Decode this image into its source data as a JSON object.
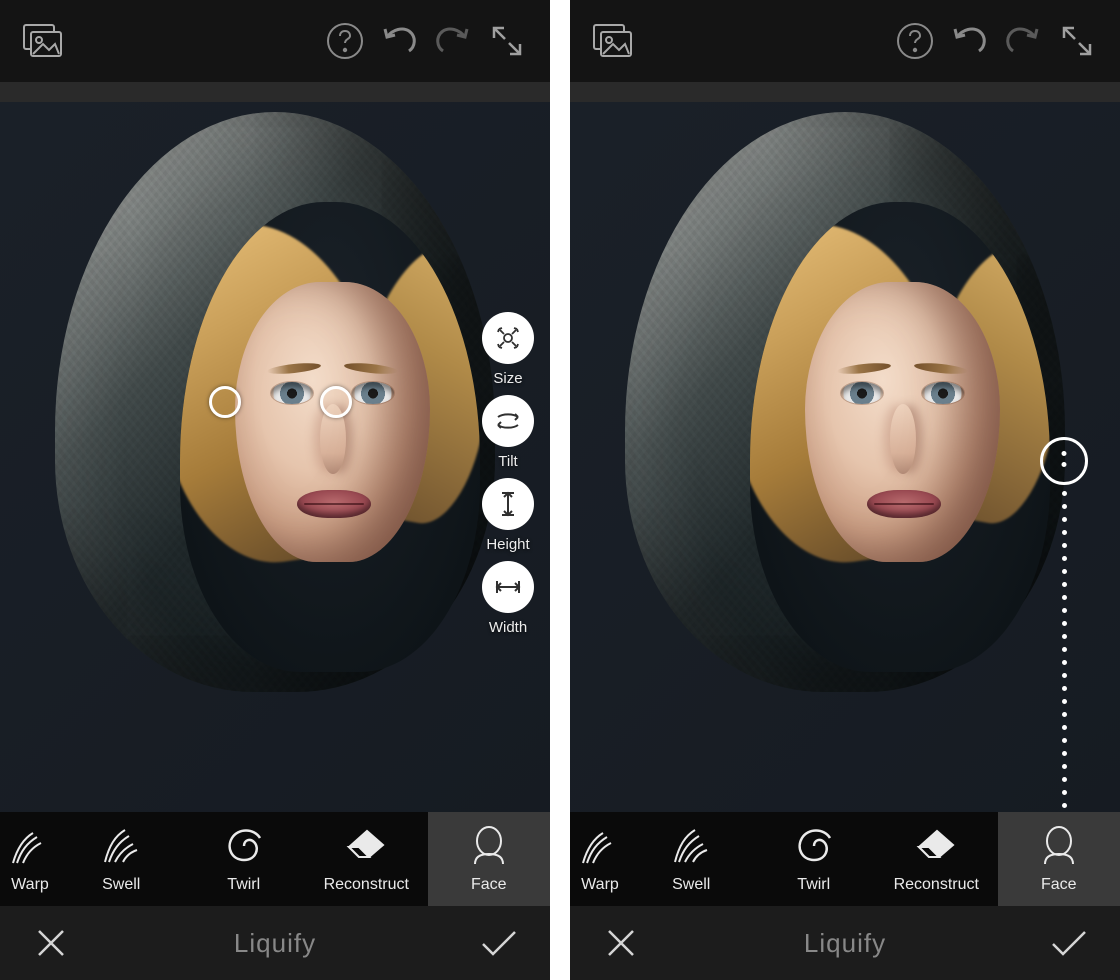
{
  "footer_label": "Liquify",
  "toolbar": {
    "warp": "Warp",
    "swell": "Swell",
    "twirl": "Twirl",
    "reconstruct": "Reconstruct",
    "face": "Face"
  },
  "face_tools": {
    "size": "Size",
    "tilt": "Tilt",
    "height": "Height",
    "width": "Width"
  }
}
